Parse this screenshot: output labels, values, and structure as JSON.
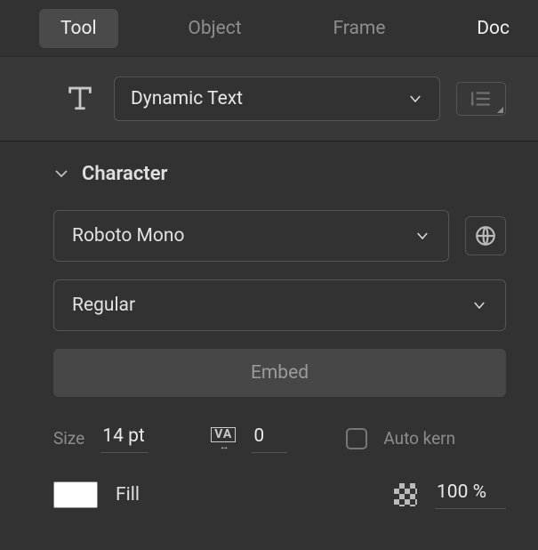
{
  "tabs": {
    "items": [
      "Tool",
      "Object",
      "Frame",
      "Doc"
    ],
    "active_index": 0
  },
  "text_type": {
    "value": "Dynamic Text"
  },
  "section": {
    "title": "Character"
  },
  "font": {
    "family": "Roboto Mono",
    "style": "Regular"
  },
  "embed": {
    "label": "Embed"
  },
  "size": {
    "label": "Size",
    "value": "14 pt"
  },
  "tracking": {
    "value": "0"
  },
  "autokern": {
    "label": "Auto kern",
    "checked": false
  },
  "fill": {
    "label": "Fill",
    "opacity": "100 %",
    "color": "#ffffff"
  }
}
